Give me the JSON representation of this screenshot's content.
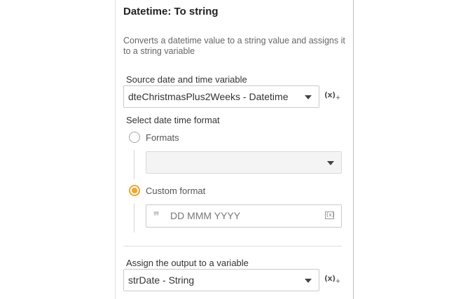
{
  "header": {
    "title": "Datetime: To string",
    "description": "Converts a datetime value to a string value and assigns it to a string variable"
  },
  "source": {
    "label": "Source date and time variable",
    "value": "dteChristmasPlus2Weeks - Datetime",
    "var_button": "(x)"
  },
  "format": {
    "label": "Select date time format",
    "options": [
      {
        "label": "Formats",
        "selected": false
      },
      {
        "label": "Custom format",
        "selected": true
      }
    ],
    "formats_select_value": "",
    "custom_format_value": "DD MMM YYYY",
    "custom_format_icon": "{x}"
  },
  "output": {
    "label": "Assign the output to a variable",
    "value": "strDate - String",
    "var_button": "(x)"
  },
  "colors": {
    "accent": "#f5a623",
    "border": "#c9c9c9",
    "text": "#333333"
  }
}
